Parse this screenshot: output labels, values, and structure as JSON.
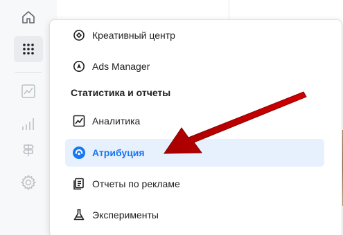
{
  "sidebar": {
    "icons": [
      "home-icon",
      "apps-grid-icon",
      "trend-chart-icon",
      "bar-chart-icon",
      "signpost-icon",
      "settings-gear-icon"
    ]
  },
  "menu": {
    "items": [
      {
        "label": "Креативный центр",
        "icon": "creative-hub-icon"
      },
      {
        "label": "Ads Manager",
        "icon": "ads-manager-icon"
      }
    ],
    "section_title": "Статистика и отчеты",
    "section_items": [
      {
        "label": "Аналитика",
        "icon": "analytics-icon"
      },
      {
        "label": "Атрибуция",
        "icon": "attribution-icon",
        "selected": true
      },
      {
        "label": "Отчеты по рекламе",
        "icon": "ads-reporting-icon"
      },
      {
        "label": "Эксперименты",
        "icon": "experiments-flask-icon"
      }
    ]
  },
  "colors": {
    "accent": "#1877f2",
    "selected_bg": "#e7f0fd",
    "annotation_arrow": "#c00000"
  }
}
